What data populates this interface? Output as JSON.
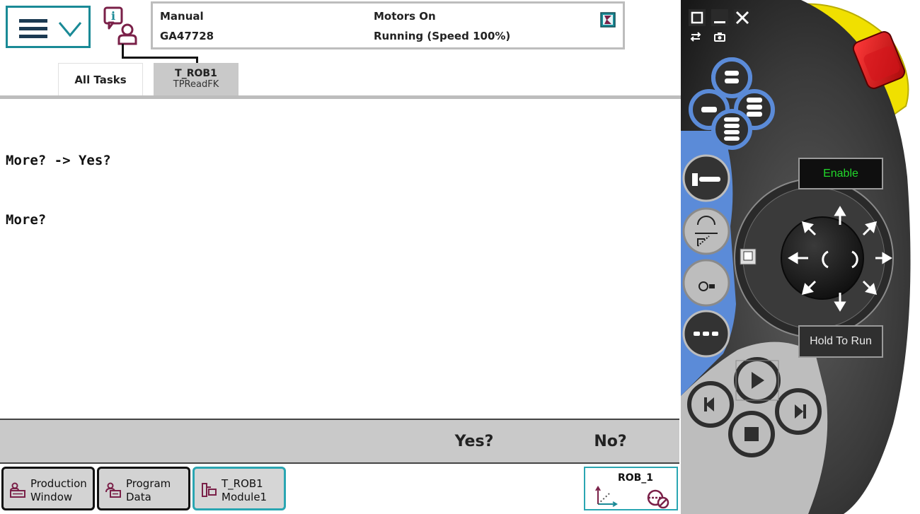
{
  "status": {
    "mode": "Manual",
    "controller_id": "GA47728",
    "motors": "Motors On",
    "run_state": "Running (Speed 100%)"
  },
  "tabs": [
    {
      "label": "All Tasks"
    },
    {
      "label": "T_ROB1",
      "sublabel": "TPReadFK"
    }
  ],
  "console": {
    "lines": [
      "More? -> Yes?",
      "More?"
    ]
  },
  "answers": {
    "yes_label": "Yes?",
    "no_label": "No?"
  },
  "taskbar": {
    "production": {
      "line1": "Production",
      "line2": "Window"
    },
    "program_data": {
      "line1": "Program",
      "line2": "Data"
    },
    "module": {
      "line1": "T_ROB1",
      "line2": "Module1"
    },
    "robot": {
      "label": "ROB_1"
    }
  },
  "pendant": {
    "enable_label": "Enable",
    "hold_to_run_label": "Hold To Run"
  },
  "colors": {
    "accent_teal": "#1a8a96",
    "icon_maroon": "#7a2048",
    "pendant_blue": "#5b8bd8",
    "enable_green": "#21d82a",
    "estop_red": "#d4141a",
    "estop_yellow": "#f0e000"
  },
  "icons": {
    "menu": "hamburger-chevron-icon",
    "info": "event-log-info-icon",
    "quickset": "quickset-icon",
    "production": "production-window-icon",
    "program_data": "program-data-icon",
    "module": "program-editor-icon",
    "robot": "jogging-coordinate-icon"
  }
}
